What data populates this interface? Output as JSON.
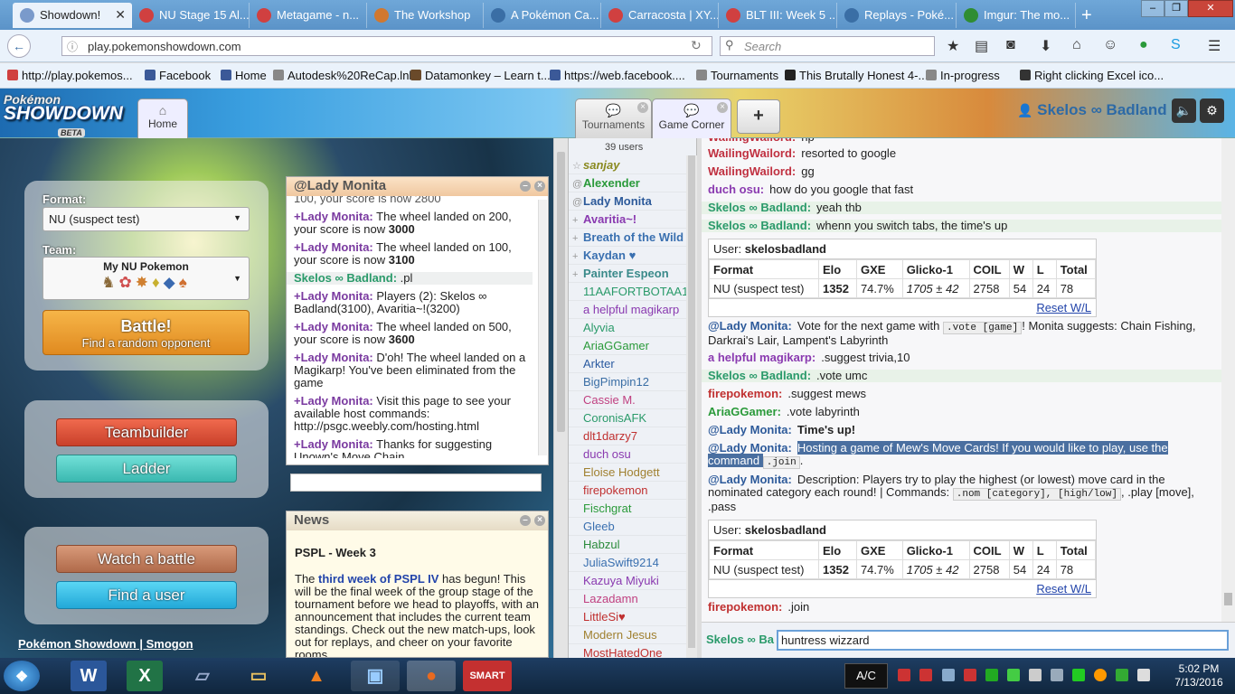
{
  "browser": {
    "tabs": [
      {
        "label": "Showdown!",
        "color": "#7a9acb",
        "active": true
      },
      {
        "label": "NU Stage 15 Al...",
        "color": "#d04040"
      },
      {
        "label": "Metagame - n...",
        "color": "#d04040"
      },
      {
        "label": "The Workshop",
        "color": "#d07830"
      },
      {
        "label": "A Pokémon Ca...",
        "color": "#3a6ea5"
      },
      {
        "label": "Carracosta | XY...",
        "color": "#d04040"
      },
      {
        "label": "BLT III: Week 5 ...",
        "color": "#d04040"
      },
      {
        "label": "Replays - Poké...",
        "color": "#3a6ea5"
      },
      {
        "label": "Imgur: The mo...",
        "color": "#2f8d33"
      }
    ],
    "new_tab": "+",
    "url": "play.pokemonshowdown.com",
    "search_placeholder": "Search",
    "bookmarks": [
      {
        "label": "http://play.pokemos...",
        "color": "#d04040"
      },
      {
        "label": "Facebook",
        "color": "#3b5998"
      },
      {
        "label": "Home",
        "color": "#3b5998"
      },
      {
        "label": "Autodesk%20ReCap.lnk",
        "color": "#888"
      },
      {
        "label": "Datamonkey – Learn t...",
        "color": "#6a4a2a"
      },
      {
        "label": "https://web.facebook....",
        "color": "#3b5998"
      },
      {
        "label": "Tournaments",
        "color": "#888"
      },
      {
        "label": "This Brutally Honest 4-...",
        "color": "#222"
      },
      {
        "label": "In-progress",
        "color": "#888"
      },
      {
        "label": "Right clicking Excel ico...",
        "color": "#333"
      }
    ]
  },
  "header": {
    "logo_top": "Pokémon",
    "logo_main": "SHOWDOWN",
    "logo_badge": "BETA",
    "home_tab": "Home",
    "room_tabs": [
      {
        "label": "Tournaments"
      },
      {
        "label": "Game Corner"
      }
    ],
    "add_room": "+",
    "username": "Skelos ∞ Badland"
  },
  "home": {
    "format_label": "Format:",
    "format_value": "NU (suspect test)",
    "team_label": "Team:",
    "team_name": "My NU Pokemon",
    "battle_label": "Battle!",
    "battle_sub": "Find a random opponent",
    "teambuilder": "Teambuilder",
    "ladder": "Ladder",
    "watch": "Watch a battle",
    "find_user": "Find a user",
    "footer_links": [
      "Pokémon Showdown",
      "Smogon"
    ]
  },
  "mini_chat": {
    "title": "@Lady Monita",
    "partial_top": "100, your score is now 2800",
    "messages": [
      {
        "name": "+Lady Monita:",
        "text": "The wheel landed on 200, your score is now ",
        "bold": "3000"
      },
      {
        "name": "+Lady Monita:",
        "text": "The wheel landed on 100, your score is now ",
        "bold": "3100"
      },
      {
        "name": "Skelos ∞ Badland:",
        "text": ".pl",
        "bold": ""
      },
      {
        "name": "+Lady Monita:",
        "text": "Players (2): Skelos ∞ Badland(3100), Avaritia~!(3200)",
        "bold": ""
      },
      {
        "name": "+Lady Monita:",
        "text": "The wheel landed on 500, your score is now ",
        "bold": "3600"
      },
      {
        "name": "+Lady Monita:",
        "text": "D'oh! The wheel landed on a Magikarp! You've been eliminated from the game",
        "bold": ""
      },
      {
        "name": "+Lady Monita:",
        "text": "Visit this page to see your available host commands: http://psgc.weebly.com/hosting.html",
        "bold": ""
      },
      {
        "name": "+Lady Monita:",
        "text": "Thanks for suggesting Unown's Move Chain.",
        "bold": ""
      }
    ]
  },
  "news": {
    "title": "News",
    "headline": "PSPL - Week 3",
    "body_pre": "The ",
    "link": "third week of PSPL IV",
    "body_post": " has begun! This will be the final week of the group stage of the tournament before we head to playoffs, with an announcement that includes the current team standings. Check out the new match-ups, look out for replays, and cheer on your favorite rooms"
  },
  "userlist": {
    "count": "39 users",
    "users": [
      {
        "rank": "☆",
        "name": "sanjay",
        "color": "#8a8a20",
        "style": "italic"
      },
      {
        "rank": "@",
        "name": "Alexender",
        "color": "#2a9a3a"
      },
      {
        "rank": "@",
        "name": "Lady Monita",
        "color": "#2d5a9a"
      },
      {
        "rank": "+",
        "name": "Avaritia~!",
        "color": "#8a3ab0"
      },
      {
        "rank": "+",
        "name": "Breath of the Wild",
        "color": "#3a70b0"
      },
      {
        "rank": "+",
        "name": "Kaydan ♥",
        "color": "#3a70b0"
      },
      {
        "rank": "+",
        "name": "Painter Espeon",
        "color": "#3a8a8a"
      },
      {
        "rank": "",
        "name": "11AAFORTBOTAA11",
        "color": "#2a9a6a"
      },
      {
        "rank": "",
        "name": "a helpful magikarp",
        "color": "#8a3ab0"
      },
      {
        "rank": "",
        "name": "Alyvia",
        "color": "#2a9a6a"
      },
      {
        "rank": "",
        "name": "AriaGGamer",
        "color": "#2a9a3a"
      },
      {
        "rank": "",
        "name": "Arkter",
        "color": "#2a5aa0"
      },
      {
        "rank": "",
        "name": "BigPimpin12",
        "color": "#3a6ea5"
      },
      {
        "rank": "",
        "name": "Cassie M.",
        "color": "#c04080"
      },
      {
        "rank": "",
        "name": "CoronisAFK",
        "color": "#2a9a6a"
      },
      {
        "rank": "",
        "name": "dlt1darzy7",
        "color": "#c03030"
      },
      {
        "rank": "",
        "name": "duch osu",
        "color": "#8a3ab0"
      },
      {
        "rank": "",
        "name": "Eloise Hodgett",
        "color": "#a08030"
      },
      {
        "rank": "",
        "name": "firepokemon",
        "color": "#c03030"
      },
      {
        "rank": "",
        "name": "Fischgrat",
        "color": "#2a9a3a"
      },
      {
        "rank": "",
        "name": "Gleeb",
        "color": "#3a70b0"
      },
      {
        "rank": "",
        "name": "Habzul",
        "color": "#2a8a3a"
      },
      {
        "rank": "",
        "name": "JuliaSwift9214",
        "color": "#3a70b0"
      },
      {
        "rank": "",
        "name": "Kazuya Miyuki",
        "color": "#8a3ab0"
      },
      {
        "rank": "",
        "name": "Lazadamn",
        "color": "#c04080"
      },
      {
        "rank": "",
        "name": "LittleSi♥",
        "color": "#c03030"
      },
      {
        "rank": "",
        "name": "Modern Jesus",
        "color": "#a08030"
      },
      {
        "rank": "",
        "name": "MostHatedOne",
        "color": "#c03030"
      }
    ]
  },
  "chat": {
    "lines": [
      {
        "name": "WailingWailord:",
        "color": "#c03040",
        "text": "rip"
      },
      {
        "name": "WailingWailord:",
        "color": "#c03040",
        "text": "resorted to google"
      },
      {
        "name": "WailingWailord:",
        "color": "#c03040",
        "text": "gg"
      },
      {
        "name": "duch osu:",
        "color": "#8a3ab0",
        "text": "how do you google that fast"
      },
      {
        "name": "Skelos ∞ Badland:",
        "color": "#2a9a6a",
        "text": "yeah thb"
      },
      {
        "name": "Skelos ∞ Badland:",
        "color": "#2a9a6a",
        "text": "whenn you switch tabs, the time's up"
      }
    ],
    "stats": {
      "user_label": "User:",
      "user": "skelosbadland",
      "headers": [
        "Format",
        "Elo",
        "GXE",
        "Glicko-1",
        "COIL",
        "W",
        "L",
        "Total"
      ],
      "row": [
        "NU (suspect test)",
        "1352",
        "74.7%",
        "1705 ± 42",
        "2758",
        "54",
        "24",
        "78"
      ],
      "reset": "Reset W/L"
    },
    "lines2": [
      {
        "name": "@Lady Monita:",
        "color": "#2d5a9a",
        "text": "Vote for the next game with ",
        "code": ".vote [game]",
        "after": "! Monita suggests: Chain Fishing, Darkrai's Lair, Lampent's Labyrinth"
      },
      {
        "name": "a helpful magikarp:",
        "color": "#8a3ab0",
        "text": ".suggest trivia,10"
      },
      {
        "name": "Skelos ∞ Badland:",
        "color": "#2a9a6a",
        "text": ".vote umc"
      },
      {
        "name": "firepokemon:",
        "color": "#c03030",
        "text": ".suggest mews"
      },
      {
        "name": "AriaGGamer:",
        "color": "#2a9a3a",
        "text": ".vote labyrinth"
      },
      {
        "name": "@Lady Monita:",
        "color": "#2d5a9a",
        "text": "Time's up!"
      },
      {
        "name": "@Lady Monita:",
        "color": "#2d5a9a",
        "text": "Hosting a game of Mew's Move Cards! If you would like to play, use the command ",
        "code": ".join",
        "after": "."
      },
      {
        "name": "@Lady Monita:",
        "color": "#2d5a9a",
        "text": "Description: Players try to play the highest (or lowest) move card in the nominated category each round! | Commands: ",
        "code": ".nom [category], [high/low]",
        "after": ", .play [move], .pass"
      }
    ],
    "last_line": {
      "name": "firepokemon:",
      "color": "#c03030",
      "text": ".join"
    },
    "input_name": "Skelos ∞ Ba",
    "input_value": "huntress wizzard"
  },
  "taskbar": {
    "lang": "A/C",
    "time": "5:02 PM",
    "date": "7/13/2016"
  }
}
